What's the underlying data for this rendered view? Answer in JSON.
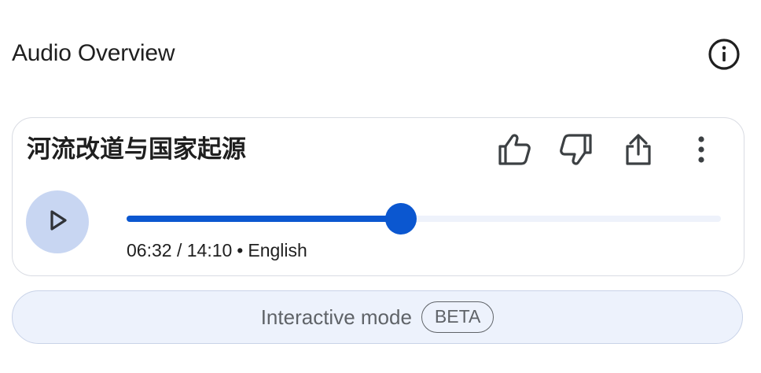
{
  "header": {
    "title": "Audio Overview",
    "info_icon": "info-icon"
  },
  "card": {
    "title": "河流改道与国家起源",
    "actions": {
      "like_icon": "thumb-up-icon",
      "dislike_icon": "thumb-down-icon",
      "share_icon": "share-icon",
      "more_icon": "more-vert-icon"
    },
    "player": {
      "play_icon": "play-icon",
      "current_time": "06:32",
      "time_separator": " / ",
      "duration": "14:10",
      "bullet": "•",
      "language": "English",
      "progress_fraction": 0.461
    }
  },
  "interactive_mode": {
    "label": "Interactive mode",
    "badge": "BETA"
  },
  "colors": {
    "accent": "#0b57d0",
    "play_button_bg": "#c8d6f2",
    "interactive_bg": "#edf2fc"
  }
}
